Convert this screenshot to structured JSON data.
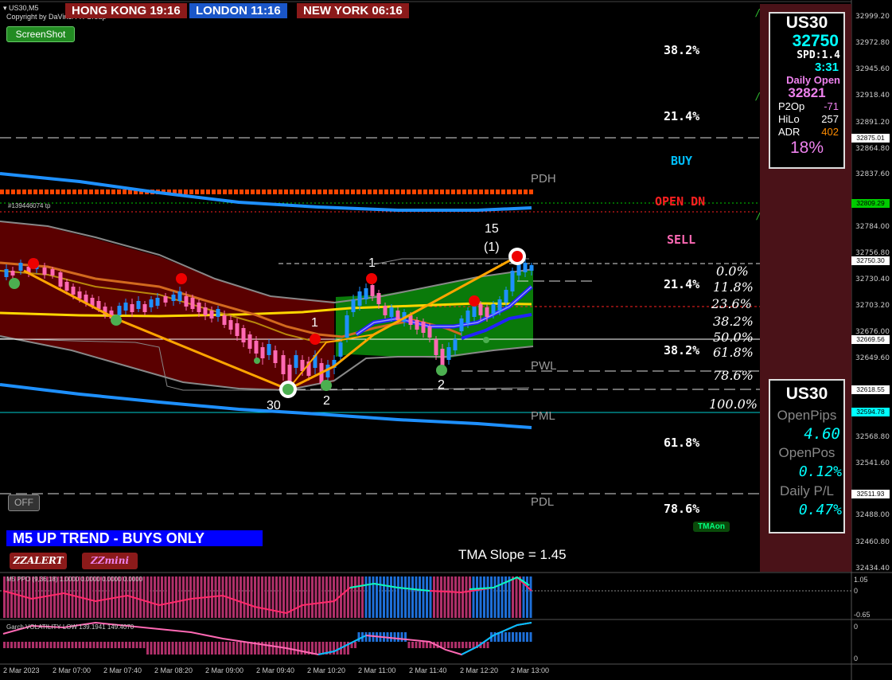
{
  "window": {
    "symbol_tf": "US30,M5",
    "copyright": "Copyright by DaVinci FX Group"
  },
  "sessions": [
    {
      "name": "HONG KONG",
      "time": "19:16"
    },
    {
      "name": "LONDON",
      "time": "11:16"
    },
    {
      "name": "NEW YORK",
      "time": "06:16"
    }
  ],
  "buttons": {
    "screenshot": "ScreenShot",
    "off": "OFF",
    "zzalert": "ZZALERT",
    "zzmini": "ZZmini",
    "tmaon": "TMAon"
  },
  "order_label": "#139446074 tp",
  "levels": {
    "pct_labels": [
      {
        "text": "38.2%",
        "color": "#87cefa"
      },
      {
        "text": "21.4%",
        "color": "#87cefa"
      },
      {
        "text": "21.4%",
        "color": "#ee82ee"
      },
      {
        "text": "38.2%",
        "color": "#87cefa"
      },
      {
        "text": "61.8%",
        "color": "#ee82ee"
      },
      {
        "text": "78.6%",
        "color": "#ee82ee"
      }
    ],
    "buy": "BUY",
    "open_dn": "OPEN  DN",
    "sell": "SELL",
    "pdh": "PDH",
    "pwl": "PWL",
    "pml": "PML",
    "pdl": "PDL",
    "fib": [
      "0.0%",
      "11.8%",
      "23.6%",
      "38.2%",
      "50.0%",
      "61.8%",
      "78.6%",
      "100.0%"
    ]
  },
  "zigzag_labels": {
    "n15": "15",
    "n1p": "(1)",
    "n1a": "1",
    "n1b": "1",
    "n30": "30",
    "n2a": "2",
    "n2b": "2"
  },
  "trend_banner": "M5 UP TREND - BUYS ONLY",
  "tma_slope": "TMA Slope = 1.45",
  "info_panel": {
    "symbol": "US30",
    "price": "32750",
    "spread": "SPD:1.4",
    "time": "3:31",
    "daily_open_label": "Daily Open",
    "daily_open": "32821",
    "rows": [
      {
        "label": "P2Op",
        "value": "-71",
        "color": "#ee82ee"
      },
      {
        "label": "HiLo",
        "value": "257",
        "color": "#ffffff"
      },
      {
        "label": "ADR",
        "value": "402",
        "color": "#ff8c00"
      }
    ],
    "adr_pct": "18%"
  },
  "pl_panel": {
    "symbol": "US30",
    "open_pips_label": "OpenPips",
    "open_pips": "4.60",
    "open_pos_label": "OpenPos",
    "open_pos": "0.12%",
    "daily_pl_label": "Daily P/L",
    "daily_pl": "0.47%"
  },
  "price_axis": [
    "32999.20",
    "32972.80",
    "32945.60",
    "32918.40",
    "32891.20",
    "32875.01",
    "32864.80",
    "32837.60",
    "32809.29",
    "32784.00",
    "32756.80",
    "32750.30",
    "32730.40",
    "32703.20",
    "32676.00",
    "32669.56",
    "32649.60",
    "32618.55",
    "32594.78",
    "32568.80",
    "32541.60",
    "32511.93",
    "32488.00",
    "32460.80",
    "32434.40"
  ],
  "sub1": {
    "label": "M5 PPO (9,36,18) 1.0000 0.0000 0.0000 0.0000",
    "axis": [
      "1.05",
      "0",
      "-0.65"
    ]
  },
  "sub2": {
    "label": "Garch VOLATILITY LOW 139.1941 149.4070",
    "axis": [
      "0",
      "0"
    ]
  },
  "time_axis": [
    "2 Mar 2023",
    "2 Mar 07:00",
    "2 Mar 07:40",
    "2 Mar 08:20",
    "2 Mar 09:00",
    "2 Mar 09:40",
    "2 Mar 10:20",
    "2 Mar 11:00",
    "2 Mar 11:40",
    "2 Mar 12:20",
    "2 Mar 13:00"
  ],
  "colors": {
    "bull": "#1e90ff",
    "bear": "#ff69b4",
    "uptrend_fill": "#0a7a0a",
    "downtrend_fill": "#5a0000",
    "zigzag": "#ffa500",
    "panel_bg": "#4a1218",
    "tma": "#ffd700"
  }
}
